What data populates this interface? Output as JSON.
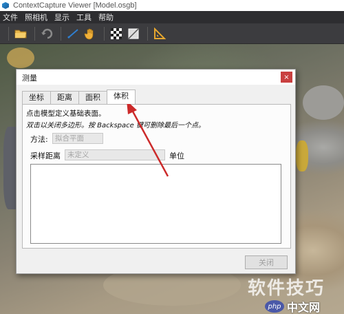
{
  "app": {
    "title": "ContextCapture Viewer [Model.osgb]"
  },
  "menu": [
    "文件",
    "照相机",
    "显示",
    "工具",
    "帮助"
  ],
  "toolbar": {
    "icons": [
      "open-folder-icon",
      "undo-icon",
      "measure-icon",
      "pan-hand-icon",
      "checkerboard-icon",
      "no-texture-icon",
      "ruler-icon"
    ]
  },
  "dialog": {
    "title": "测量",
    "close_label": "×",
    "tabs": [
      "坐标",
      "距离",
      "面积",
      "体积"
    ],
    "active_tab": "体积",
    "hint_line1": "点击模型定义基础表面。",
    "hint_line2": "双击以关闭多边形。按 Backspace 键可删除最后一个点。",
    "method_label": "方法:",
    "method_value": "拟合平面",
    "sampling_label": "采样距离",
    "sampling_value": "未定义",
    "unit_label": "单位",
    "close_button": "关闭"
  },
  "watermark": {
    "line1": "软件技巧",
    "badge": "php",
    "site": "中文网"
  },
  "colors": {
    "accent_close": "#c94040",
    "annotation_arrow": "#cc2a2a"
  }
}
